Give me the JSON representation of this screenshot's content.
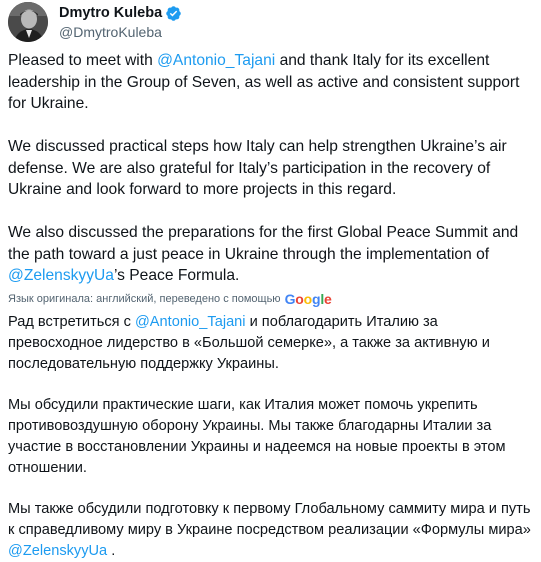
{
  "author": {
    "display_name": "Dmytro Kuleba",
    "handle": "@DmytroKuleba",
    "verified_icon": "verified-badge-icon",
    "verified_color": "#1d9bf0"
  },
  "original": {
    "p1_a": "Pleased to meet with ",
    "p1_mention": "@Antonio_Tajani",
    "p1_b": " and thank Italy for its excellent leadership in the Group of Seven, as well as active and consistent support for Ukraine.",
    "p2": "We discussed practical steps how Italy can help strengthen Ukraine’s air defense. We are also grateful for Italy’s participation in the recovery of Ukraine and look forward to more projects in this regard.",
    "p3_a": "We also discussed the preparations for the first Global Peace Summit and the path toward a just peace in Ukraine through the implementation of ",
    "p3_mention": "@ZelenskyyUa",
    "p3_b": "’s Peace Formula."
  },
  "translation_note": {
    "text": "Язык оригинала: английский, переведено с помощью",
    "provider": "Google"
  },
  "translated": {
    "p1_a": "Рад встретиться с ",
    "p1_mention": "@Antonio_Tajani",
    "p1_b": " и поблагодарить Италию за превосходное лидерство в «Большой семерке», а также за активную и последовательную поддержку Украины.",
    "p2": "Мы обсудили практические шаги, как Италия может помочь укрепить противовоздушную оборону Украины. Мы также благодарны Италии за участие в восстановлении Украины и надеемся на новые проекты в этом отношении.",
    "p3_a": "Мы также обсудили подготовку к первому Глобальному саммиту мира и путь к справедливому миру в Украине посредством реализации «Формулы мира» ",
    "p3_mention": "@ZelenskyyUa",
    "p3_b": " ."
  },
  "colors": {
    "mention": "#1d9bf0",
    "text": "#0f1419",
    "secondary": "#536471"
  }
}
